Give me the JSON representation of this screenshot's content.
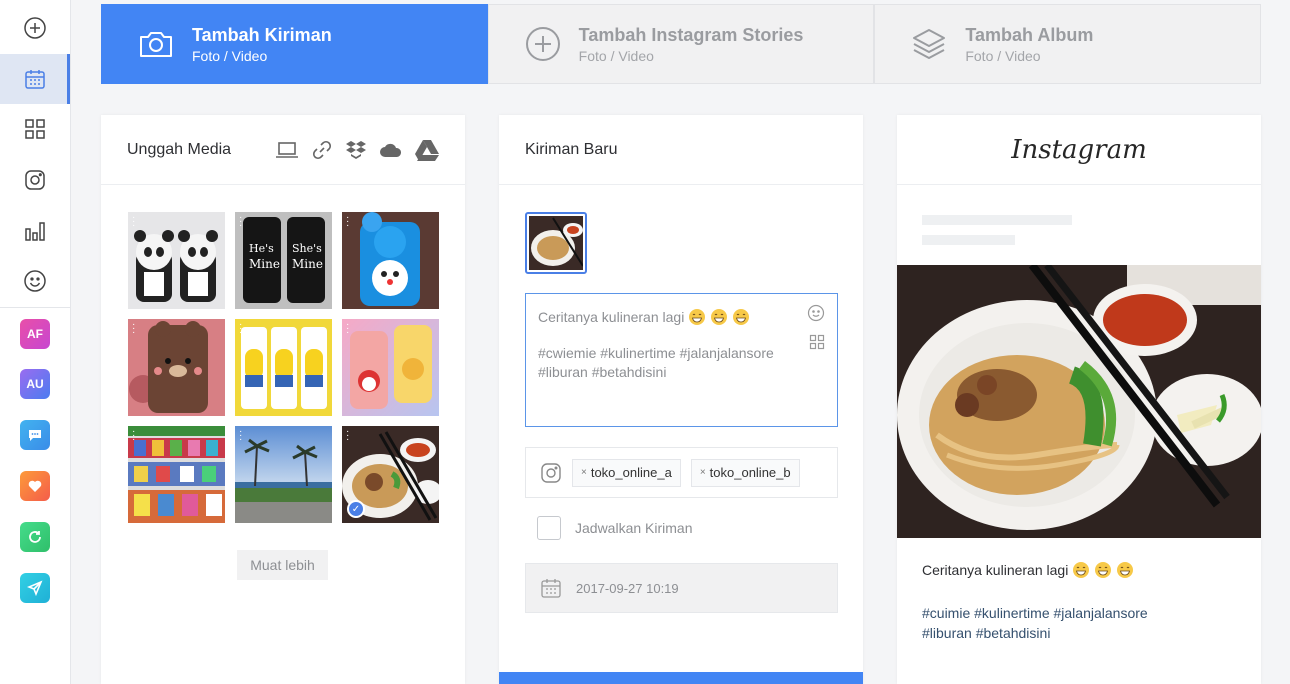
{
  "tabs": [
    {
      "title": "Tambah Kiriman",
      "subtitle": "Foto / Video",
      "icon": "camera-icon",
      "active": true
    },
    {
      "title": "Tambah Instagram Stories",
      "subtitle": "Foto / Video",
      "icon": "plus-circle-icon",
      "active": false
    },
    {
      "title": "Tambah Album",
      "subtitle": "Foto / Video",
      "icon": "layers-icon",
      "active": false
    }
  ],
  "sidebar": {
    "nav_icons": [
      "plus-circle-icon",
      "calendar-icon",
      "grid-icon",
      "instagram-icon",
      "bar-chart-icon",
      "smiley-icon"
    ],
    "apps": [
      {
        "label": "AF",
        "color": "#e04bb4"
      },
      {
        "label": "AU",
        "color": "#7d6cf0"
      },
      {
        "label": "",
        "icon": "chat-icon",
        "color": "#3aa6ec"
      },
      {
        "label": "",
        "icon": "heart-icon",
        "color": "#f77d3b"
      },
      {
        "label": "",
        "icon": "refresh-icon",
        "color": "#3dd17a"
      },
      {
        "label": "",
        "icon": "send-icon",
        "color": "#27c2de"
      }
    ]
  },
  "upload": {
    "title": "Unggah Media",
    "source_icons": [
      "laptop-icon",
      "link-icon",
      "dropbox-icon",
      "cloud-icon",
      "google-drive-icon"
    ],
    "more_label": "Muat lebih"
  },
  "new_post": {
    "title": "Kiriman Baru",
    "caption_text": "Ceritanya kulineran lagi",
    "hashtags_text": "#cwiemie #kulinertime #jalanjalansore #liburan #betahdisini",
    "accounts": [
      "toko_online_a",
      "toko_online_b"
    ],
    "schedule_label": "Jadwalkan Kiriman",
    "datetime": "2017-09-27 10:19"
  },
  "preview": {
    "brand": "Instagram",
    "caption_text": "Ceritanya kulineran lagi",
    "hashtags_text": "#cuimie #kulinertime #jalanjalansore #liburan #betahdisini"
  },
  "colors": {
    "accent": "#4285f4",
    "tab_inactive_bg": "#f1f1f2",
    "hashtag": "#35506e"
  }
}
